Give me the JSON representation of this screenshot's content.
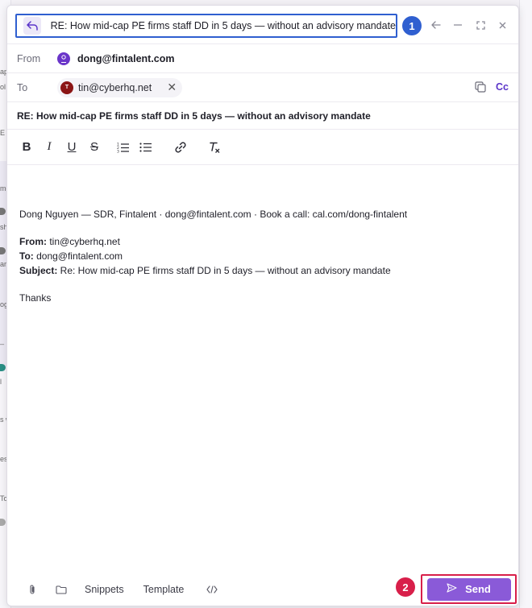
{
  "background": {
    "fragments": [
      "ap",
      "ol i",
      "E f",
      "me",
      "sh",
      "ar",
      "og",
      "_",
      "l",
      "s w",
      "es",
      "To"
    ]
  },
  "compose": {
    "title": "RE: How mid-cap PE firms staff DD in 5 days — without an advisory mandate",
    "annotation_1": "1",
    "annotation_2": "2",
    "from_label": "From",
    "from_email": "dong@fintalent.com",
    "to_label": "To",
    "to_avatar_initial": "T",
    "to_email": "tin@cyberhq.net",
    "cc_label": "Cc",
    "subject": "RE: How mid-cap PE firms staff DD in 5 days — without an advisory mandate",
    "body": {
      "signature": "Dong Nguyen — SDR, Fintalent · dong@fintalent.com · Book a call: cal.com/dong-fintalent",
      "from_key": "From:",
      "from_val": " tin@cyberhq.net",
      "to_key": "To:",
      "to_val": " dong@fintalent.com",
      "subject_key": "Subject:",
      "subject_val": " Re: How mid-cap PE firms staff DD in 5 days — without an advisory mandate",
      "closing": "Thanks"
    },
    "footer": {
      "snippets_label": "Snippets",
      "template_label": "Template",
      "send_label": "Send"
    }
  },
  "colors": {
    "accent": "#5b35c9",
    "send_button": "#8a5ad8",
    "annotation_blue": "#2f5fd0",
    "annotation_red": "#d81f4a"
  }
}
